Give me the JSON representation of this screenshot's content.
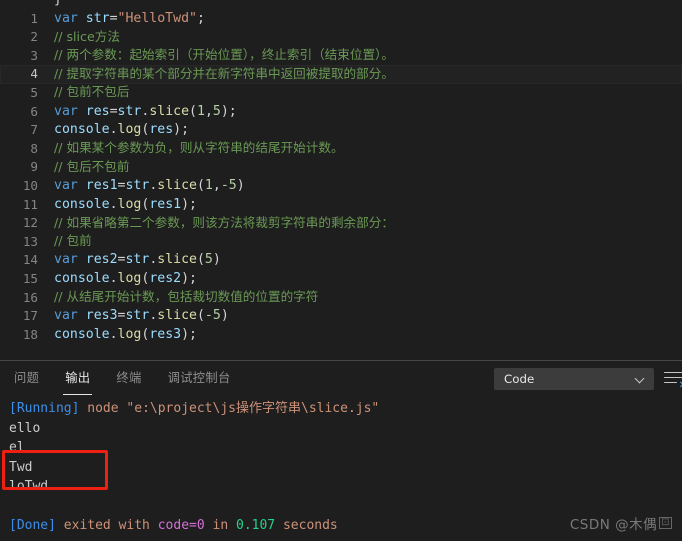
{
  "editor": {
    "partial_top_line": "}",
    "lines": [
      {
        "num": "1",
        "active": false,
        "tokens": [
          {
            "t": "var ",
            "c": "k"
          },
          {
            "t": "str",
            "c": "vr"
          },
          {
            "t": "=",
            "c": "pl"
          },
          {
            "t": "\"HelloTwd\"",
            "c": "st"
          },
          {
            "t": ";",
            "c": "pl"
          }
        ]
      },
      {
        "num": "2",
        "active": false,
        "tokens": [
          {
            "t": "// slice方法",
            "c": "cm"
          }
        ]
      },
      {
        "num": "3",
        "active": false,
        "tokens": [
          {
            "t": "// 两个参数：起始索引（开始位置），终止索引（结束位置）。",
            "c": "cm"
          }
        ]
      },
      {
        "num": "4",
        "active": true,
        "tokens": [
          {
            "t": "// 提取字符串的某个部分并在新字符串中返回被提取的部分。",
            "c": "cm"
          }
        ]
      },
      {
        "num": "5",
        "active": false,
        "tokens": [
          {
            "t": "// 包前不包后",
            "c": "cm"
          }
        ]
      },
      {
        "num": "6",
        "active": false,
        "tokens": [
          {
            "t": "var ",
            "c": "k"
          },
          {
            "t": "res",
            "c": "vr"
          },
          {
            "t": "=",
            "c": "pl"
          },
          {
            "t": "str",
            "c": "vr"
          },
          {
            "t": ".",
            "c": "pl"
          },
          {
            "t": "slice",
            "c": "fn"
          },
          {
            "t": "(",
            "c": "pl"
          },
          {
            "t": "1",
            "c": "nm"
          },
          {
            "t": ",",
            "c": "pl"
          },
          {
            "t": "5",
            "c": "nm"
          },
          {
            "t": ");",
            "c": "pl"
          }
        ]
      },
      {
        "num": "7",
        "active": false,
        "tokens": [
          {
            "t": "console",
            "c": "vr"
          },
          {
            "t": ".",
            "c": "pl"
          },
          {
            "t": "log",
            "c": "fn"
          },
          {
            "t": "(",
            "c": "pl"
          },
          {
            "t": "res",
            "c": "vr"
          },
          {
            "t": ");",
            "c": "pl"
          }
        ]
      },
      {
        "num": "8",
        "active": false,
        "tokens": [
          {
            "t": "// 如果某个参数为负，则从字符串的结尾开始计数。",
            "c": "cm"
          }
        ]
      },
      {
        "num": "9",
        "active": false,
        "tokens": [
          {
            "t": "// 包后不包前",
            "c": "cm"
          }
        ]
      },
      {
        "num": "10",
        "active": false,
        "tokens": [
          {
            "t": "var ",
            "c": "k"
          },
          {
            "t": "res1",
            "c": "vr"
          },
          {
            "t": "=",
            "c": "pl"
          },
          {
            "t": "str",
            "c": "vr"
          },
          {
            "t": ".",
            "c": "pl"
          },
          {
            "t": "slice",
            "c": "fn"
          },
          {
            "t": "(",
            "c": "pl"
          },
          {
            "t": "1",
            "c": "nm"
          },
          {
            "t": ",",
            "c": "pl"
          },
          {
            "t": "-5",
            "c": "nm"
          },
          {
            "t": ")",
            "c": "pl"
          }
        ]
      },
      {
        "num": "11",
        "active": false,
        "tokens": [
          {
            "t": "console",
            "c": "vr"
          },
          {
            "t": ".",
            "c": "pl"
          },
          {
            "t": "log",
            "c": "fn"
          },
          {
            "t": "(",
            "c": "pl"
          },
          {
            "t": "res1",
            "c": "vr"
          },
          {
            "t": ");",
            "c": "pl"
          }
        ]
      },
      {
        "num": "12",
        "active": false,
        "tokens": [
          {
            "t": "// 如果省略第二个参数，则该方法将裁剪字符串的剩余部分：",
            "c": "cm"
          }
        ]
      },
      {
        "num": "13",
        "active": false,
        "tokens": [
          {
            "t": "// 包前",
            "c": "cm"
          }
        ]
      },
      {
        "num": "14",
        "active": false,
        "tokens": [
          {
            "t": "var ",
            "c": "k"
          },
          {
            "t": "res2",
            "c": "vr"
          },
          {
            "t": "=",
            "c": "pl"
          },
          {
            "t": "str",
            "c": "vr"
          },
          {
            "t": ".",
            "c": "pl"
          },
          {
            "t": "slice",
            "c": "fn"
          },
          {
            "t": "(",
            "c": "pl"
          },
          {
            "t": "5",
            "c": "nm"
          },
          {
            "t": ")",
            "c": "pl"
          }
        ]
      },
      {
        "num": "15",
        "active": false,
        "tokens": [
          {
            "t": "console",
            "c": "vr"
          },
          {
            "t": ".",
            "c": "pl"
          },
          {
            "t": "log",
            "c": "fn"
          },
          {
            "t": "(",
            "c": "pl"
          },
          {
            "t": "res2",
            "c": "vr"
          },
          {
            "t": ");",
            "c": "pl"
          }
        ]
      },
      {
        "num": "16",
        "active": false,
        "tokens": [
          {
            "t": "// 从结尾开始计数，包括裁切数值的位置的字符",
            "c": "cm"
          }
        ]
      },
      {
        "num": "17",
        "active": false,
        "tokens": [
          {
            "t": "var ",
            "c": "k"
          },
          {
            "t": "res3",
            "c": "vr"
          },
          {
            "t": "=",
            "c": "pl"
          },
          {
            "t": "str",
            "c": "vr"
          },
          {
            "t": ".",
            "c": "pl"
          },
          {
            "t": "slice",
            "c": "fn"
          },
          {
            "t": "(",
            "c": "pl"
          },
          {
            "t": "-5",
            "c": "nm"
          },
          {
            "t": ")",
            "c": "pl"
          }
        ]
      },
      {
        "num": "18",
        "active": false,
        "tokens": [
          {
            "t": "console",
            "c": "vr"
          },
          {
            "t": ".",
            "c": "pl"
          },
          {
            "t": "log",
            "c": "fn"
          },
          {
            "t": "(",
            "c": "pl"
          },
          {
            "t": "res3",
            "c": "vr"
          },
          {
            "t": ");",
            "c": "pl"
          }
        ]
      }
    ]
  },
  "panel": {
    "tabs": [
      {
        "label": "问题",
        "active": false
      },
      {
        "label": "输出",
        "active": true
      },
      {
        "label": "终端",
        "active": false
      },
      {
        "label": "调试控制台",
        "active": false
      }
    ],
    "channel_selector": {
      "value": "Code",
      "chevron_icon": "chevron-down-icon"
    },
    "clear_output_icon": "clear-output-icon",
    "output_lines": [
      {
        "segs": [
          {
            "t": "[Running]",
            "c": "o-blue"
          },
          {
            "t": " node \"e:\\project\\js操作字符串\\slice.js\"",
            "c": "o-orange"
          }
        ]
      },
      {
        "segs": [
          {
            "t": "ello",
            "c": "o-white"
          }
        ]
      },
      {
        "segs": [
          {
            "t": "el",
            "c": "o-white"
          }
        ]
      },
      {
        "segs": [
          {
            "t": "Twd",
            "c": "o-white"
          }
        ]
      },
      {
        "segs": [
          {
            "t": "loTwd",
            "c": "o-white"
          }
        ]
      },
      {
        "segs": [
          {
            "t": "",
            "c": "o-white"
          }
        ]
      },
      {
        "segs": [
          {
            "t": "[Done]",
            "c": "o-blue"
          },
          {
            "t": " exited with ",
            "c": "o-orange"
          },
          {
            "t": "code=0",
            "c": "o-mag"
          },
          {
            "t": " in ",
            "c": "o-orange"
          },
          {
            "t": "0.107",
            "c": "o-green"
          },
          {
            "t": " seconds",
            "c": "o-orange"
          }
        ]
      }
    ],
    "highlight_box": {
      "color": "#ee2012"
    }
  },
  "watermark": {
    "text": "CSDN @木偶",
    "glyph": "⊡"
  },
  "colors": {
    "editor_bg": "#1e1e1e",
    "active_line_bg": "#222223",
    "keyword": "#569cd6",
    "variable": "#9cdcfe",
    "string": "#ce9178",
    "comment": "#6a9955",
    "function": "#dcdcaa",
    "number": "#b5cea8",
    "accent_blue": "#3b8eea",
    "highlight_red": "#ee2012"
  }
}
